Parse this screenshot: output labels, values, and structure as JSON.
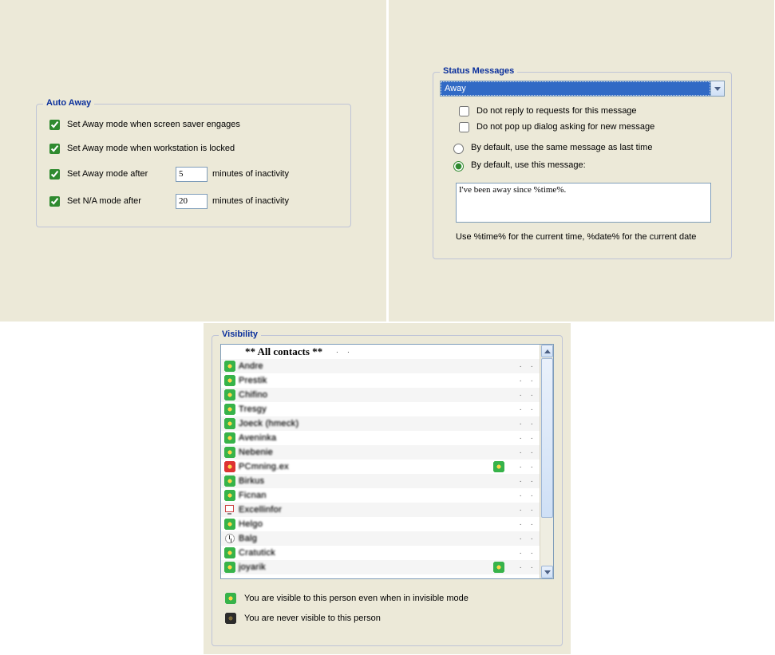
{
  "autoAway": {
    "title": "Auto Away",
    "screenSaverLabel": "Set Away mode when screen saver engages",
    "screenSaverChecked": true,
    "lockedLabel": "Set Away mode when workstation is locked",
    "lockedChecked": true,
    "awayAfterLabelPre": "Set Away mode after",
    "awayAfterChecked": true,
    "awayAfterValue": "5",
    "naAfterLabelPre": "Set N/A mode after",
    "naAfterChecked": true,
    "naAfterValue": "20",
    "minutesLabel": "minutes of inactivity"
  },
  "statusMessages": {
    "title": "Status Messages",
    "selected": "Away",
    "doNotReplyLabel": "Do not reply to requests for this message",
    "doNotReplyChecked": false,
    "doNotPopupLabel": "Do not pop up dialog asking for new message",
    "doNotPopupChecked": false,
    "sameAsLastLabel": "By default, use the same message as last time",
    "useThisLabel": "By default, use this message:",
    "radioSelected": "useThis",
    "messageText": "I've been away since %time%.",
    "hint": "Use %time% for the current time, %date% for the current date"
  },
  "visibility": {
    "title": "Visibility",
    "header": "** All contacts **",
    "legendVisible": "You are visible to this person even when in invisible mode",
    "legendNever": "You are never visible to this person",
    "contacts": [
      {
        "name": "Andre",
        "icon": "flower-green",
        "badge": ""
      },
      {
        "name": "Prestik",
        "icon": "flower-green",
        "badge": ""
      },
      {
        "name": "Chifino",
        "icon": "flower-green",
        "badge": ""
      },
      {
        "name": "Tresgy",
        "icon": "flower-green",
        "badge": ""
      },
      {
        "name": "Joeck (hmeck)",
        "icon": "flower-green",
        "badge": ""
      },
      {
        "name": "Aveninka",
        "icon": "flower-green",
        "badge": ""
      },
      {
        "name": "Nebenie",
        "icon": "flower-green",
        "badge": ""
      },
      {
        "name": "PCmning.ex",
        "icon": "flower-red",
        "badge": "flower-green"
      },
      {
        "name": "Birkus",
        "icon": "flower-green",
        "badge": ""
      },
      {
        "name": "Ficnan",
        "icon": "flower-green",
        "badge": ""
      },
      {
        "name": "Excellinfor",
        "icon": "monitor",
        "badge": ""
      },
      {
        "name": "Helgo",
        "icon": "flower-green",
        "badge": ""
      },
      {
        "name": "Balg",
        "icon": "clock",
        "badge": ""
      },
      {
        "name": "Cratutick",
        "icon": "flower-green",
        "badge": ""
      },
      {
        "name": "joyarik",
        "icon": "flower-green",
        "badge": "flower-green"
      }
    ]
  }
}
